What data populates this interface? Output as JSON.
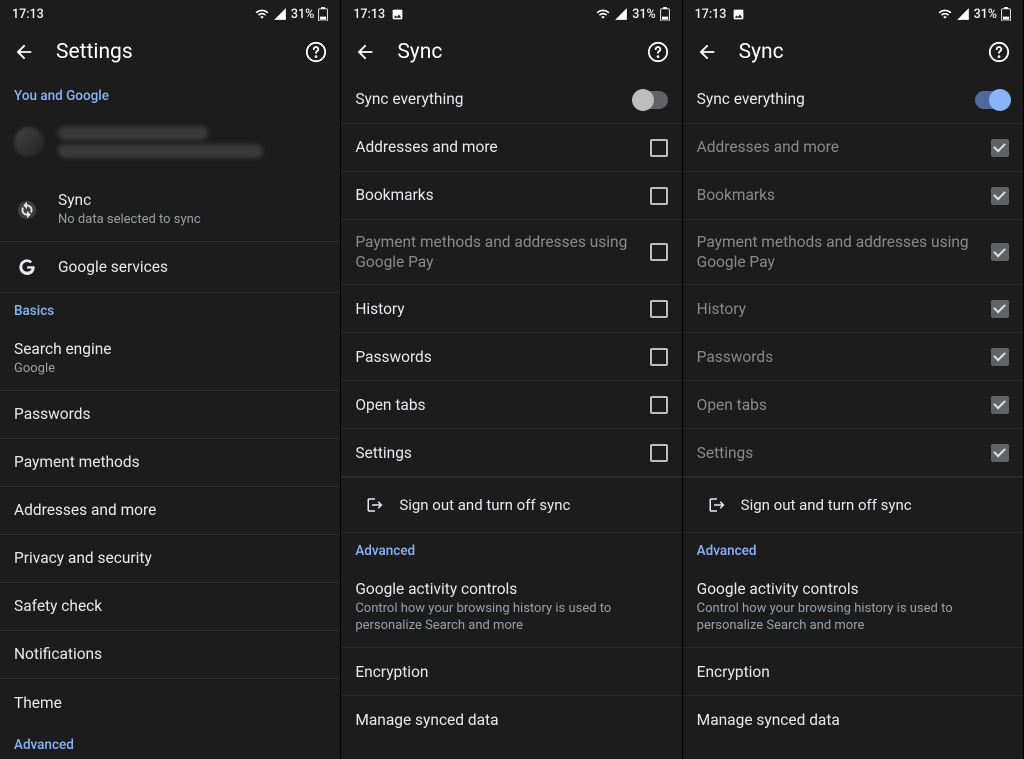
{
  "statusbar": {
    "time": "17:13",
    "battery": "31%"
  },
  "panel1": {
    "appbar_title": "Settings",
    "sections": {
      "you_and_google": "You and Google",
      "sync_title": "Sync",
      "sync_sub": "No data selected to sync",
      "google_services": "Google services",
      "basics": "Basics",
      "search_engine": "Search engine",
      "search_engine_sub": "Google",
      "passwords": "Passwords",
      "payment_methods": "Payment methods",
      "addresses": "Addresses and more",
      "privacy": "Privacy and security",
      "safety_check": "Safety check",
      "notifications": "Notifications",
      "theme": "Theme",
      "advanced": "Advanced"
    }
  },
  "sync_common": {
    "appbar_title": "Sync",
    "sync_everything": "Sync everything",
    "addresses": "Addresses and more",
    "bookmarks": "Bookmarks",
    "payment_gpay": "Payment methods and addresses using Google Pay",
    "history": "History",
    "passwords": "Passwords",
    "open_tabs": "Open tabs",
    "settings": "Settings",
    "sign_out": "Sign out and turn off sync",
    "advanced": "Advanced",
    "gac_title": "Google activity controls",
    "gac_sub": "Control how your browsing history is used to personalize Search and more",
    "encryption": "Encryption",
    "manage_synced": "Manage synced data"
  }
}
